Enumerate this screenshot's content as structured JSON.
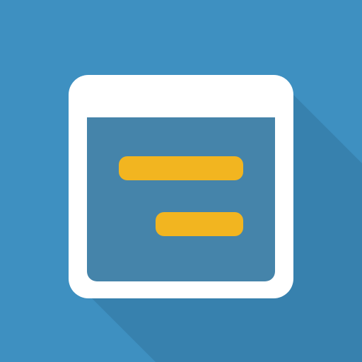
{
  "icon": {
    "name": "text-window-icon",
    "colors": {
      "background": "#3e90c1",
      "shadow": "#2f6f97",
      "window_frame": "#ffffff",
      "window_content": "#4584aa",
      "accent_bars": "#f2b520"
    }
  }
}
